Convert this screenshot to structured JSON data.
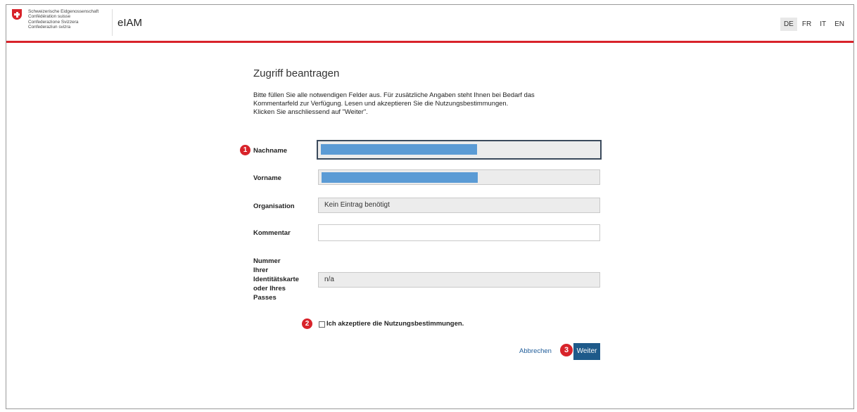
{
  "header": {
    "confederation_lines": [
      "Schweizerische Eidgenossenschaft",
      "Confédération suisse",
      "Confederazione Svizzera",
      "Confederaziun svizra"
    ],
    "app_title": "eIAM",
    "languages": [
      "DE",
      "FR",
      "IT",
      "EN"
    ],
    "active_language": "DE",
    "accent_color": "#d8232a"
  },
  "form": {
    "title": "Zugriff beantragen",
    "intro_lines": [
      "Bitte füllen Sie alle notwendigen Felder aus. Für zusätzliche Angaben steht Ihnen bei Bedarf das",
      "Kommentarfeld zur Verfügung. Lesen und akzeptieren Sie die Nutzungsbestimmungen.",
      "Klicken Sie anschliessend auf \"Weiter\"."
    ],
    "fields": {
      "nachname": {
        "label": "Nachname",
        "value": ""
      },
      "vorname": {
        "label": "Vorname",
        "value": ""
      },
      "organisation": {
        "label": "Organisation",
        "value": "Kein Eintrag benötigt"
      },
      "kommentar": {
        "label": "Kommentar",
        "value": ""
      },
      "id_number": {
        "label_lines": [
          "Nummer",
          "Ihrer",
          "Identitätskarte",
          "oder Ihres",
          "Passes"
        ],
        "value": "n/a"
      }
    },
    "terms_label": "Ich akzeptiere die Nutzungsbestimmungen.",
    "terms_checked": false,
    "cancel_label": "Abbrechen",
    "next_label": "Weiter"
  },
  "markers": [
    "1",
    "2",
    "3"
  ]
}
